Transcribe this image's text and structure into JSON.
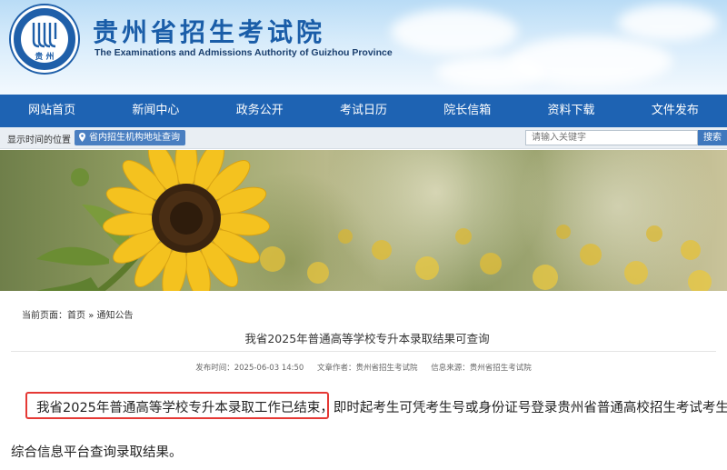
{
  "header": {
    "logo_text": "贵 州",
    "title": "贵州省招生考试院",
    "subtitle": "The Examinations and Admissions Authority of Guizhou Province"
  },
  "nav": {
    "items": [
      {
        "label": "网站首页"
      },
      {
        "label": "新闻中心"
      },
      {
        "label": "政务公开"
      },
      {
        "label": "考试日历"
      },
      {
        "label": "院长信箱"
      },
      {
        "label": "资料下载"
      },
      {
        "label": "文件发布"
      }
    ]
  },
  "subbar": {
    "time_position": "显示时间的位置",
    "institution_link": "省内招生机构地址查询",
    "search_placeholder": "请输入关键字",
    "search_button": "搜索"
  },
  "breadcrumb": {
    "prefix": "当前页面：",
    "home": "首页",
    "separator": "»",
    "current": "通知公告"
  },
  "article": {
    "title": "我省2025年普通高等学校专升本录取结果可查询",
    "publish_time": "发布时间：2025-06-03 14:50",
    "author": "文章作者：贵州省招生考试院",
    "source": "信息来源：贵州省招生考试院",
    "para1_highlight": "我省2025年普通高等学校专升本录取工作已结束，",
    "para1_rest": "即时起考生可凭考生号或身份证号登录贵州省普通高校招生考试考生",
    "para2": "综合信息平台查询录取结果。"
  },
  "colors": {
    "nav_bg": "#1e63b3",
    "title_blue": "#1a5da8",
    "highlight_border": "#e53935"
  }
}
